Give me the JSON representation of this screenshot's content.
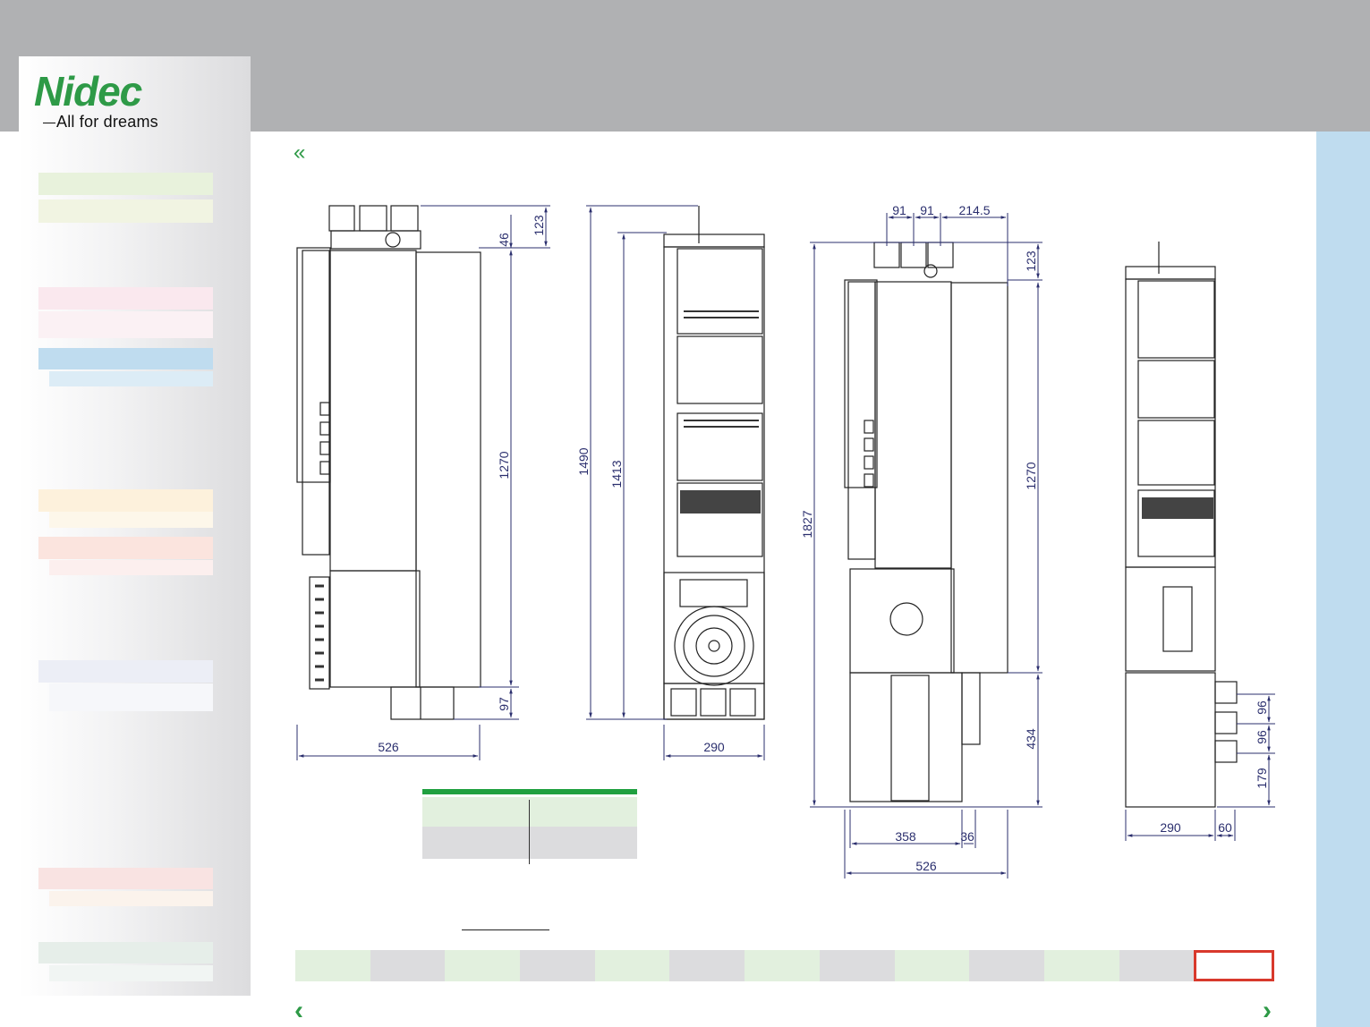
{
  "brand": {
    "logo_text": "Nidec",
    "tagline": "All for dreams",
    "accent": "#2e9a47"
  },
  "colors": {
    "header": "#b0b1b3",
    "right_strip": "#bfdcef",
    "table_band": "#20a040",
    "active_tab_border": "#d8392c"
  },
  "sidebar": {
    "swatches": [
      {
        "color": "#e8f2dc"
      },
      {
        "color": "#f1f4e2"
      },
      {
        "color": "#fae8ee"
      },
      {
        "color": "#fbf1f4"
      },
      {
        "color": "#bfdcef"
      },
      {
        "color": "#dcecf6"
      },
      {
        "color": "#fdf1dc"
      },
      {
        "color": "#fdf7ea"
      },
      {
        "color": "#fbe4de"
      },
      {
        "color": "#fcefee"
      },
      {
        "color": "#eceef6"
      },
      {
        "color": "#f6f7fa"
      },
      {
        "color": "#f9e3e2"
      },
      {
        "color": "#fbf3ec"
      },
      {
        "color": "#e6eee9"
      },
      {
        "color": "#f1f5f3"
      }
    ]
  },
  "navigation": {
    "back_icon": "double-chevron-left-icon",
    "prev_icon": "chevron-left-icon",
    "next_icon": "chevron-right-icon",
    "back_glyph": "«",
    "prev_glyph": "‹",
    "next_glyph": "›"
  },
  "drawings": {
    "front_view_1": {
      "width": "526",
      "top_offset": "123",
      "upper": "46",
      "body": "1270",
      "bottom": "97"
    },
    "side_view_1": {
      "width": "290",
      "overall": "1490",
      "body": "1413"
    },
    "front_view_2": {
      "spacing_a": "91",
      "spacing_b": "91",
      "spacing_c": "214.5",
      "top_offset": "123",
      "overall": "1827",
      "body": "1270",
      "lower": "434",
      "width_a": "358",
      "width_b": "36",
      "width_total": "526"
    },
    "side_view_2": {
      "spacing_a": "96",
      "spacing_b": "96",
      "bottom": "179",
      "width": "290",
      "offset": "60"
    }
  },
  "table": {
    "rows": 2
  },
  "pager": {
    "tabs": [
      "#e2f0de",
      "#dcdcde",
      "#e2f0de",
      "#dcdcde",
      "#e2f0de",
      "#dcdcde",
      "#e2f0de",
      "#dcdcde",
      "#e2f0de",
      "#dcdcde",
      "#e2f0de",
      "#dcdcde",
      "active"
    ]
  }
}
